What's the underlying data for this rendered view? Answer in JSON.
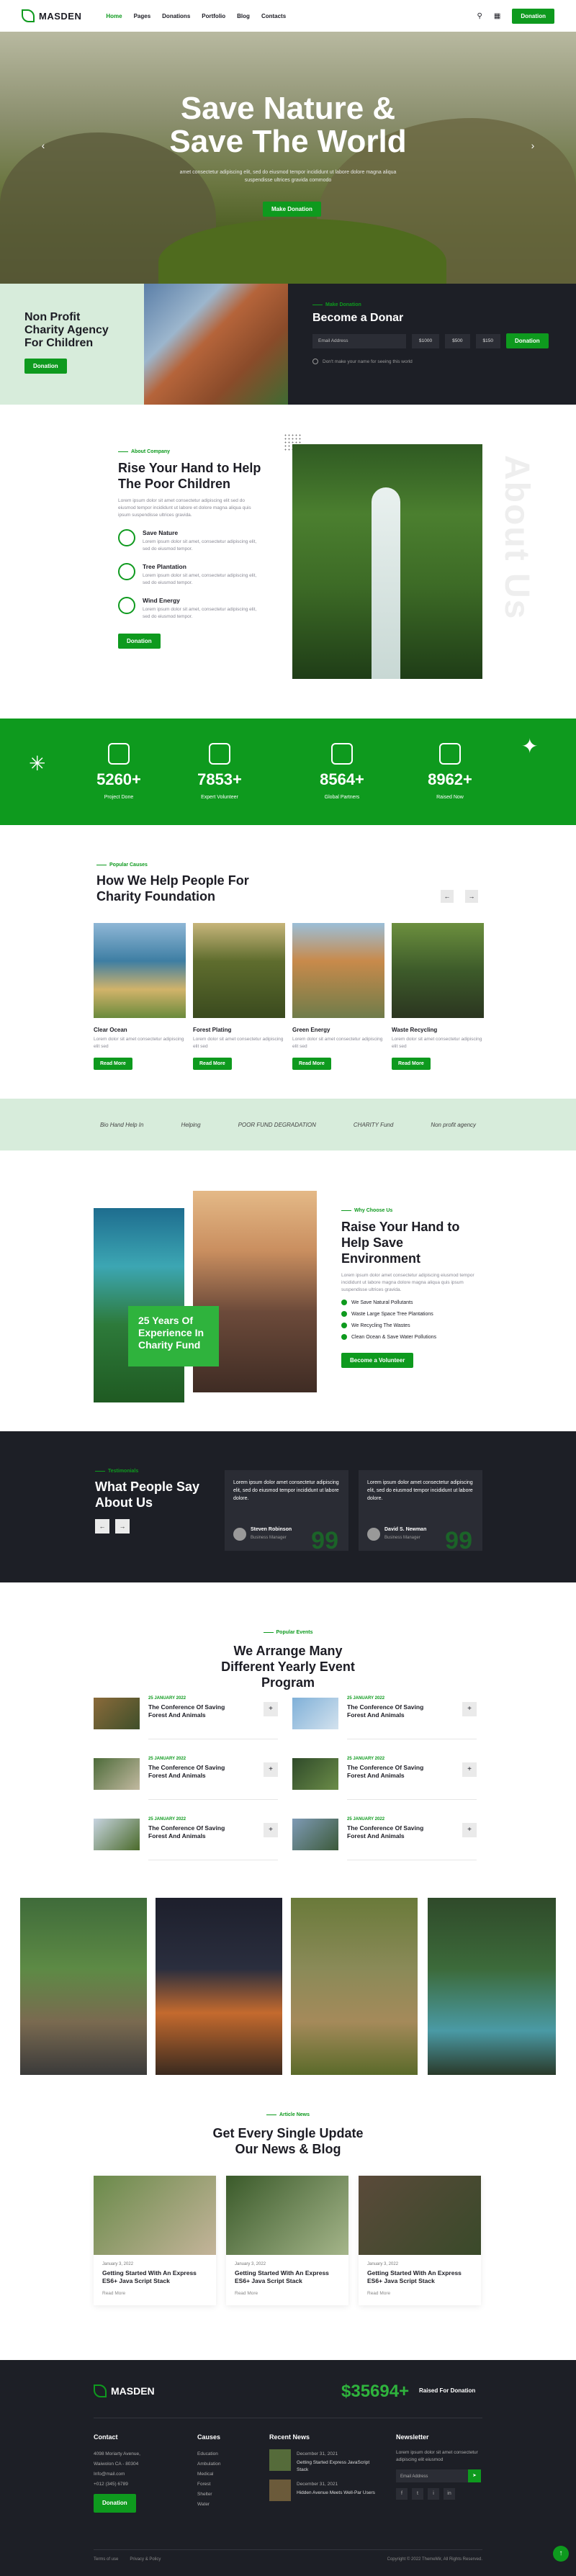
{
  "brand": {
    "name": "MASDEN",
    "accent": "#0e9a1e",
    "dark": "#1d1f26",
    "mint": "#d7ecdb"
  },
  "nav": {
    "items": [
      "Home",
      "Pages",
      "Donations",
      "Portfolio",
      "Blog",
      "Contacts"
    ],
    "donation_button": "Donation"
  },
  "hero": {
    "title": "Save Nature &\nSave The World",
    "subtitle": "amet consectetur adipiscing elit, sed do eiusmod tempor incididunt ut labore dolore magna aliqua suspendisse ultrices gravida commodo",
    "button": "Make Donation"
  },
  "nonprofit": {
    "title": "Non Profit\nCharity Agency\nFor Children",
    "button": "Donation"
  },
  "donar": {
    "tag": "Make Donation",
    "title": "Become a Donar",
    "email_placeholder": "Email Address",
    "amounts": [
      "$1000",
      "$500",
      "$150"
    ],
    "button": "Donation",
    "anon_label": "Don't make your name for seeing this world"
  },
  "about": {
    "tag": "About Company",
    "title": "Rise Your Hand to Help The Poor Children",
    "text": "Lorem ipsum dolor sit amet consectetur adipiscing elit sed do eiusmod tempor incididunt ut labore et dolore magna aliqua quis ipsum suspendisse ultrices gravida.",
    "features": [
      {
        "title": "Save Nature",
        "text": "Lorem ipsum dolor sit amet, consectetur adipiscing elit, sed do eiusmod tempor."
      },
      {
        "title": "Tree Plantation",
        "text": "Lorem ipsum dolor sit amet, consectetur adipiscing elit, sed do eiusmod tempor."
      },
      {
        "title": "Wind Energy",
        "text": "Lorem ipsum dolor sit amet, consectetur adipiscing elit, sed do eiusmod tempor."
      }
    ],
    "button": "Donation",
    "vertical_text": "About Us"
  },
  "stats": [
    {
      "value": "5260+",
      "label": "Project Done"
    },
    {
      "value": "7853+",
      "label": "Expert Volunteer"
    },
    {
      "value": "8564+",
      "label": "Global Partners"
    },
    {
      "value": "8962+",
      "label": "Raised Now"
    }
  ],
  "causes": {
    "tag": "Popular Causes",
    "title": "How We Help People For Charity Foundation",
    "items": [
      {
        "title": "Clear Ocean",
        "text": "Lorem dolor sit amet consectetur adipiscing elit sed",
        "button": "Read More"
      },
      {
        "title": "Forest Plating",
        "text": "Lorem dolor sit amet consectetur adipiscing elit sed",
        "button": "Read More"
      },
      {
        "title": "Green Energy",
        "text": "Lorem dolor sit amet consectetur adipiscing elit sed",
        "button": "Read More"
      },
      {
        "title": "Waste Recycling",
        "text": "Lorem dolor sit amet consectetur adipiscing elit sed",
        "button": "Read More"
      }
    ]
  },
  "partners": [
    "Bio Hand Help In",
    "Helping",
    "POOR FUND DEGRADATION",
    "CHARITY Fund",
    "Non profit agency"
  ],
  "why": {
    "tag": "Why Choose Us",
    "title": "Raise Your Hand to Help Save Environment",
    "text": "Lorem ipsum dolor amet consectetur adipiscing eiusmod tempor incididunt ut labore magna dolore magna aliqua quis ipsum suspendisse ultrices gravida.",
    "checks": [
      "We Save Natural Pollutants",
      "Waste Large Space Tree Plantations",
      "We Recycling The Wastes",
      "Clean Ocean & Save Water Pollutions"
    ],
    "badge": "25 Years Of\nExperience In\nCharity Fund",
    "button": "Become a Volunteer"
  },
  "testimonials": {
    "tag": "Testimonials",
    "title": "What People Say About Us",
    "items": [
      {
        "text": "Lorem ipsum dolor amet consectetur adipiscing elit, sed do eiusmod tempor incididunt ut labore dolore.",
        "name": "Steven Robinson",
        "role": "Business Manager"
      },
      {
        "text": "Lorem ipsum dolor amet consectetur adipiscing elit, sed do eiusmod tempor incididunt ut labore dolore.",
        "name": "David S. Newman",
        "role": "Business Manager"
      }
    ]
  },
  "events": {
    "tag": "Popular Events",
    "title": "We Arrange Many Different Yearly Event Program",
    "items": [
      {
        "date": "25 JANUARY 2022",
        "title": "The Conference Of Saving Forest And Animals"
      },
      {
        "date": "25 JANUARY 2022",
        "title": "The Conference Of Saving Forest And Animals"
      },
      {
        "date": "25 JANUARY 2022",
        "title": "The Conference Of Saving Forest And Animals"
      },
      {
        "date": "25 JANUARY 2022",
        "title": "The Conference Of Saving Forest And Animals"
      },
      {
        "date": "25 JANUARY 2022",
        "title": "The Conference Of Saving Forest And Animals"
      },
      {
        "date": "25 JANUARY 2022",
        "title": "The Conference Of Saving Forest And Animals"
      }
    ]
  },
  "news": {
    "tag": "Article News",
    "title": "Get Every Single Update Our News & Blog",
    "items": [
      {
        "date": "January 3, 2022",
        "title": "Getting Started With An Express ES6+ Java Script Stack",
        "more": "Read More"
      },
      {
        "date": "January 3, 2022",
        "title": "Getting Started With An Express ES6+ Java Script Stack",
        "more": "Read More"
      },
      {
        "date": "January 3, 2022",
        "title": "Getting Started With An Express ES6+ Java Script Stack",
        "more": "Read More"
      }
    ]
  },
  "footer": {
    "raised_amount": "$35694+",
    "raised_label": "Raised For Donation",
    "contact": {
      "title": "Contact",
      "address": "4098 Moriarty Avenue, Waiwolon CA - 80304",
      "email": "Info@mail.com",
      "phone": "+012 (345) 6789",
      "button": "Donation"
    },
    "causes": {
      "title": "Causes",
      "items": [
        "Education",
        "Ambulation",
        "Medical",
        "Forest",
        "Shelter",
        "Water"
      ]
    },
    "recent": {
      "title": "Recent News",
      "items": [
        {
          "date": "December 31, 2021",
          "title": "Getting Started Express JavaScript Stack"
        },
        {
          "date": "December 31, 2021",
          "title": "Hidden Avenue Meets Well-Par Users"
        }
      ]
    },
    "newsletter": {
      "title": "Newsletter",
      "text": "Lorem ipsum dolor sit amet consectetur adipiscing elit eiusmod",
      "placeholder": "Email Address"
    },
    "links": [
      "Terms of use",
      "Privacy & Policy"
    ],
    "copyright": "Copyright © 2022 ThemeMir, All Rights Reserved."
  }
}
